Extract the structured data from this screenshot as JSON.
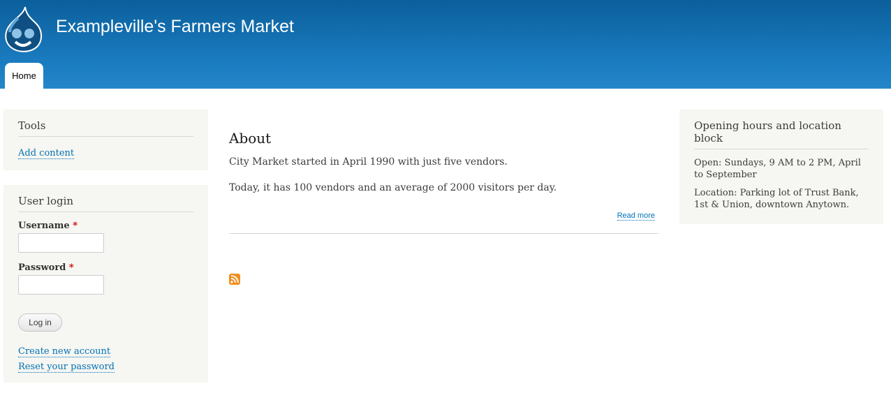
{
  "header": {
    "site_name": "Exampleville's Farmers Market",
    "nav": [
      {
        "label": "Home"
      }
    ]
  },
  "sidebar": {
    "tools": {
      "title": "Tools",
      "link": "Add content"
    },
    "user_login": {
      "title": "User login",
      "username_label": "Username",
      "password_label": "Password",
      "required_marker": "*",
      "login_button": "Log in",
      "create_account": "Create new account",
      "reset_password": "Reset your password"
    }
  },
  "main": {
    "title": "About",
    "paragraphs": [
      "City Market started in April 1990 with just five vendors.",
      "Today, it has 100 vendors and an average of 2000 visitors per day."
    ],
    "read_more": "Read more",
    "feed_icon": "rss-feed-icon"
  },
  "right_sidebar": {
    "title": "Opening hours and location block",
    "open": "Open: Sundays, 9 AM to 2 PM, April to September",
    "location": "Location: Parking lot of Trust Bank, 1st & Union, downtown Anytown."
  },
  "colors": {
    "header_top": "#0b5f9b",
    "header_bottom": "#2587c9",
    "link": "#0071b3",
    "sidebar_bg": "#f6f6f2",
    "required": "#cc0000",
    "rss": "#f28e1f"
  }
}
